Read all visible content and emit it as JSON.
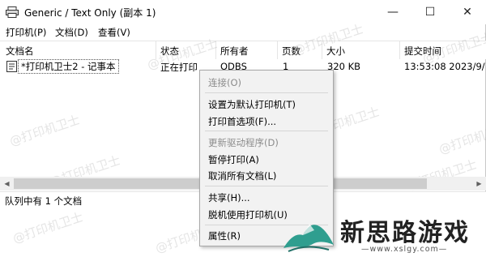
{
  "window": {
    "title": "Generic / Text Only (副本 1)",
    "minimize_glyph": "—",
    "maximize_glyph": "☐",
    "close_glyph": "✕"
  },
  "menubar": [
    {
      "label": "打印机(P)"
    },
    {
      "label": "文档(D)"
    },
    {
      "label": "查看(V)"
    }
  ],
  "columns": [
    "文档名",
    "状态",
    "所有者",
    "页数",
    "大小",
    "提交时间"
  ],
  "jobs": [
    {
      "document": "*打印机卫士2 - 记事本",
      "status": "正在打印",
      "owner": "ODBS",
      "pages": "1",
      "size": "320 KB",
      "submitted": "13:53:08  2023/9/"
    }
  ],
  "statusbar": {
    "text": "队列中有 1 个文档"
  },
  "watermark": "@打印机卫士",
  "context_menu": {
    "items": [
      {
        "label": "连接(O)",
        "disabled": true
      },
      {
        "label": "设置为默认打印机(T)",
        "disabled": false
      },
      {
        "label": "打印首选项(F)...",
        "disabled": false
      },
      {
        "label": "更新驱动程序(D)",
        "disabled": true
      },
      {
        "label": "暂停打印(A)",
        "disabled": false
      },
      {
        "label": "取消所有文档(L)",
        "disabled": false
      },
      {
        "label": "共享(H)...",
        "disabled": false
      },
      {
        "label": "脱机使用打印机(U)",
        "disabled": false
      },
      {
        "label": "属性(R)",
        "disabled": false
      }
    ]
  },
  "brand": {
    "name": "新思路游戏",
    "url": "—www.xslgy.com—",
    "accent_color": "#2f9e8f"
  },
  "colors": {
    "scrollbar_track": "#f0f0f0",
    "scrollbar_thumb": "#cdcdcd",
    "menu_bg": "#f2f2f2",
    "disabled_text": "#8c8c8c"
  }
}
